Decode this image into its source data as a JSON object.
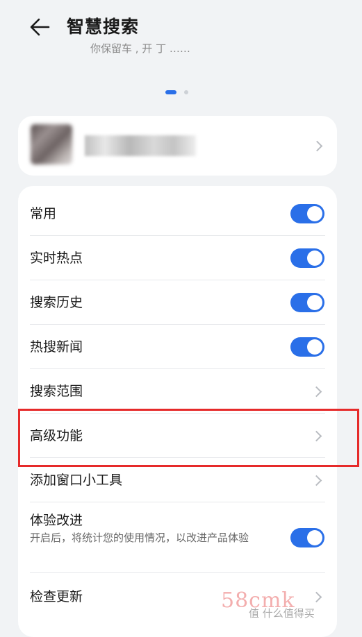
{
  "header": {
    "title": "智慧搜索",
    "subtitle_partial": "你保留车 ,  开 丁 ……"
  },
  "pager": {
    "pages": 2,
    "active_page": 1
  },
  "account": {
    "name": "",
    "avatar": "blurred"
  },
  "settings": [
    {
      "label": "常用",
      "control": "toggle",
      "on": true
    },
    {
      "label": "实时热点",
      "control": "toggle",
      "on": true
    },
    {
      "label": "搜索历史",
      "control": "toggle",
      "on": true
    },
    {
      "label": "热搜新闻",
      "control": "toggle",
      "on": true
    },
    {
      "label": "搜索范围",
      "control": "chevron"
    },
    {
      "label": "高级功能",
      "control": "chevron",
      "highlighted": true
    },
    {
      "label": "添加窗口小工具",
      "control": "chevron"
    },
    {
      "label": "体验改进",
      "description": "开启后，将统计您的使用情况，以改进产品体验",
      "control": "toggle",
      "on": true
    },
    {
      "label": "检查更新",
      "control": "chevron"
    }
  ],
  "watermark": {
    "main": "58cmk",
    "secondary": "值 什么值得买"
  },
  "colors": {
    "accent": "#2a6fe8",
    "highlight_border": "#e62a2a",
    "background": "#f1f3f5"
  }
}
